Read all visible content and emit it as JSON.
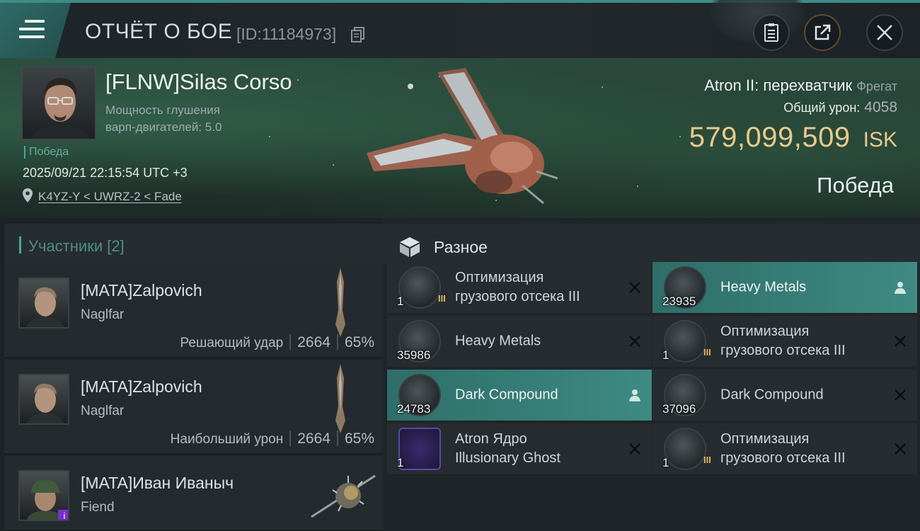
{
  "header": {
    "title": "ОТЧЁТ О БОЕ",
    "report_id": "[ID:11184973]"
  },
  "victim": {
    "pilot_name": "[FLNW]Silas Corso",
    "attribute_line1": "Мощность глушения",
    "attribute_line2": "варп-двигателей: 5.0",
    "result_small": "Победа",
    "datetime": "2025/09/21 22:15:54 UTC +3",
    "location": "K4YZ-Y < UWRZ-2 < Fade",
    "ship_name": "Atron II: перехватчик",
    "ship_class": "Фрегат",
    "damage_label": "Общий урон:",
    "damage_value": "4058",
    "isk_value": "579,099,509",
    "isk_unit": "ISK",
    "result_big": "Победа"
  },
  "participants": {
    "heading": "Участники [2]",
    "items": [
      {
        "name": "[MATA]Zalpovich",
        "ship": "Naglfar",
        "role": "Решающий удар",
        "damage": "2664",
        "percent": "65%"
      },
      {
        "name": "[MATA]Zalpovich",
        "ship": "Naglfar",
        "role": "Наибольший урон",
        "damage": "2664",
        "percent": "65%"
      },
      {
        "name": "[MATA]Иван Иваныч",
        "ship": "Fiend",
        "badge": "i"
      }
    ]
  },
  "misc": {
    "heading": "Разное",
    "items": [
      {
        "qty": "1",
        "meta": "III",
        "line1": "Оптимизация",
        "line2": "грузового отсека III",
        "status": "destroyed",
        "highlight": false
      },
      {
        "qty": "23935",
        "line1": "Heavy Metals",
        "line2": "",
        "status": "dropped",
        "highlight": true
      },
      {
        "qty": "35986",
        "line1": "Heavy Metals",
        "line2": "",
        "status": "destroyed",
        "highlight": false
      },
      {
        "qty": "1",
        "meta": "III",
        "line1": "Оптимизация",
        "line2": "грузового отсека III",
        "status": "destroyed",
        "highlight": false
      },
      {
        "qty": "24783",
        "line1": "Dark Compound",
        "line2": "",
        "status": "dropped",
        "highlight": true
      },
      {
        "qty": "37096",
        "line1": "Dark Compound",
        "line2": "",
        "status": "destroyed",
        "highlight": false
      },
      {
        "qty": "1",
        "line1": "Atron Ядро",
        "line2": "Illusionary Ghost",
        "status": "destroyed",
        "highlight": false
      },
      {
        "qty": "1",
        "meta": "III",
        "line1": "Оптимизация",
        "line2": "грузового отсека III",
        "status": "destroyed",
        "highlight": false
      }
    ]
  },
  "colors": {
    "accent": "#4aa79d",
    "isk": "#e9c98b",
    "highlight": "#3e8a83"
  },
  "icons": {
    "menu": "hamburger-icon",
    "copy": "copy-icon",
    "clipboard": "clipboard-icon",
    "share": "share-icon",
    "close": "close-icon",
    "location": "location-pin-icon",
    "misc": "cube-box-icon",
    "destroyed": "x-icon",
    "dropped": "person-icon"
  }
}
